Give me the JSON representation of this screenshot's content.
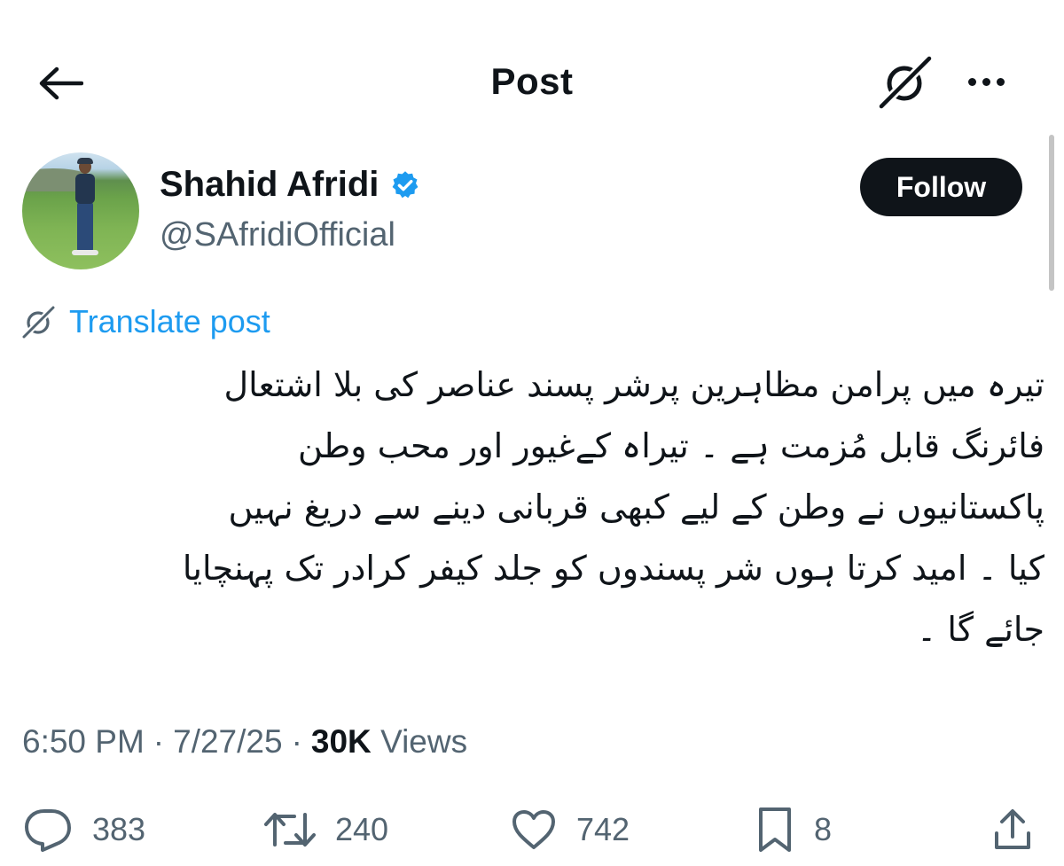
{
  "header": {
    "title": "Post",
    "back_icon": "arrow-left-icon",
    "grok_icon": "grok-icon",
    "more_icon": "more-horizontal-icon"
  },
  "author": {
    "name": "Shahid Afridi",
    "handle": "@SAfridiOfficial",
    "verified": true,
    "verified_color": "#1d9bf0",
    "follow_label": "Follow"
  },
  "translate": {
    "label": "Translate post",
    "icon": "grok-icon"
  },
  "post": {
    "lines": [
      "تیرہ میں پرامن مظاہرین پرشر پسند عناصر کی بلا اشتعال",
      "فائرنگ قابل مُزمت ہے ۔  تیراہ کےغیور اور محب وطن",
      "پاکستانیوں نے وطن کے لیے کبھی  قربانی دینے سے دریغ نہیں",
      "کیا ۔ امید کرتا ہوں شر پسندوں کو جلد کیفر کرادر تک پہنچایا",
      "جائے گا ۔"
    ]
  },
  "meta": {
    "time": "6:50 PM",
    "separator": "·",
    "date": "7/27/25",
    "views_count": "30K",
    "views_label": "Views"
  },
  "actions": {
    "replies": "383",
    "reposts": "240",
    "likes": "742",
    "bookmarks": "8"
  },
  "colors": {
    "text": "#0f1419",
    "secondary": "#536471",
    "accent": "#1d9bf0",
    "follow_bg": "#0f1419"
  }
}
